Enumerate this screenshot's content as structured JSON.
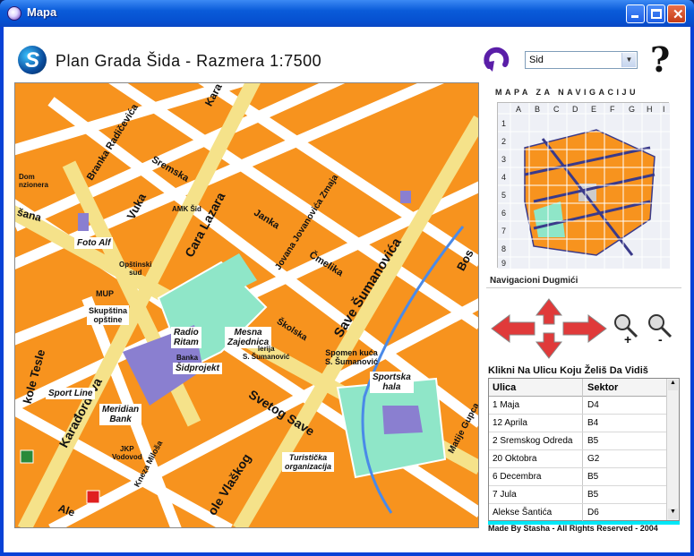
{
  "window": {
    "title": "Mapa"
  },
  "header": {
    "title": "Plan Grada Šida - Razmera 1:7500",
    "select_value": "Sid",
    "help_glyph": "?"
  },
  "navigation": {
    "title": "MAPA ZA NAVIGACIJU",
    "columns": [
      "A",
      "B",
      "C",
      "D",
      "E",
      "F",
      "G",
      "H",
      "I"
    ],
    "rows": [
      "1",
      "2",
      "3",
      "4",
      "5",
      "6",
      "7",
      "8",
      "9"
    ],
    "buttons_title": "Navigacioni Dugmići"
  },
  "streets_panel": {
    "heading": "Klikni Na Ulicu Koju Želiš Da Vidiš",
    "col_ulica": "Ulica",
    "col_sektor": "Sektor",
    "rows": [
      {
        "ulica": "1 Maja",
        "sektor": "D4"
      },
      {
        "ulica": "12 Aprila",
        "sektor": "B4"
      },
      {
        "ulica": "2 Sremskog Odreda",
        "sektor": "B5"
      },
      {
        "ulica": "20 Oktobra",
        "sektor": "G2"
      },
      {
        "ulica": "6 Decembra",
        "sektor": "B5"
      },
      {
        "ulica": "7 Jula",
        "sektor": "B5"
      },
      {
        "ulica": "Alekse Šantića",
        "sektor": "D6"
      }
    ]
  },
  "footer": "Made By Stasha - All Rights Reserved - 2004",
  "map": {
    "streets": {
      "branka": "Branka Radičevića",
      "sremska": "Sremska",
      "vuka": "Vuka",
      "cara_lazara": "Cara Lazara",
      "janka": "Janka",
      "jovana": "Jovana Jovanovića Zmaja",
      "cmelika": "Čmelika",
      "save_sumanovica": "Save Šumanovića",
      "skolska": "Školska",
      "svetog_save": "Svetog Save",
      "karadjordjeva": "Karađorđeva",
      "kole_tesle": "kole Tesle",
      "kneza_milosa": "Kneza Miloša",
      "vlaskog": "ole Vlaškog",
      "matije_gupca": "Matije Gupca",
      "bosa": "Bos",
      "sana": "šana",
      "kara": "Kara",
      "ale": "Ale"
    },
    "places": {
      "dom": "Dom\nnzionera",
      "amk": "AMK Šid",
      "foto_alf": "Foto Alf",
      "opstinski": "Opštinski\nsud",
      "mup": "MUP",
      "skupstina": "Skupština\nopštine",
      "radio_ritam": "Radio\nRitam",
      "mesna": "Mesna\nZajednica",
      "galerija": "lerija\nS. Šumanović",
      "spomen": "Spomen kuća\nS. Šumanović",
      "banka": "Banka",
      "sidprojekt": "Šidprojekt",
      "sport_line": "Sport Line",
      "meridian": "Meridian\nBank",
      "jkp": "JKP\nVodovod",
      "turisticka": "Turistička\norganizacija",
      "sportska": "Sportska\nhala"
    }
  }
}
